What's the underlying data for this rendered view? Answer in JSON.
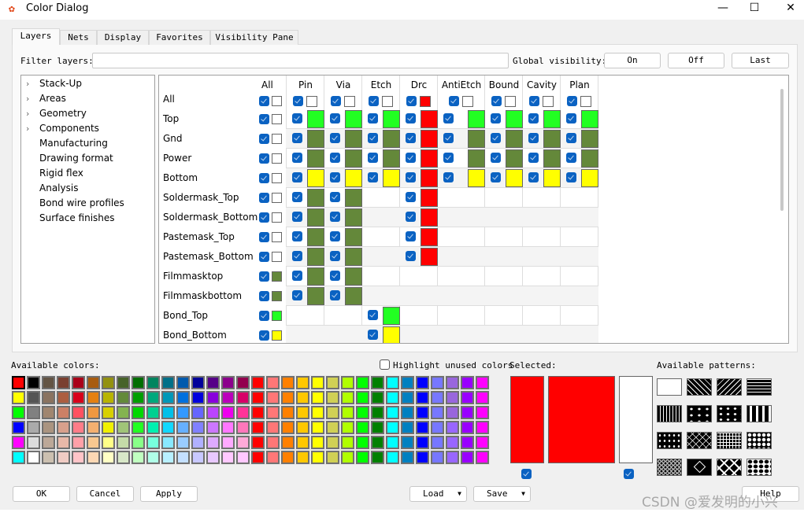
{
  "window": {
    "title": "Color Dialog",
    "icon": "color-palette-icon",
    "minimize": "—",
    "maximize": "☐",
    "close": "✕"
  },
  "tabs": [
    {
      "label": "Layers",
      "active": true
    },
    {
      "label": "Nets"
    },
    {
      "label": "Display"
    },
    {
      "label": "Favorites"
    },
    {
      "label": "Visibility Pane"
    }
  ],
  "filter": {
    "label": "Filter layers:",
    "value": "",
    "placeholder": ""
  },
  "global_visibility": {
    "label": "Global visibility:",
    "on": "On",
    "off": "Off",
    "last": "Last"
  },
  "tree": [
    {
      "label": "Stack-Up",
      "expandable": true
    },
    {
      "label": "Areas",
      "expandable": true
    },
    {
      "label": "Geometry",
      "expandable": true
    },
    {
      "label": "Components",
      "expandable": true
    },
    {
      "label": "Manufacturing"
    },
    {
      "label": "Drawing format"
    },
    {
      "label": "Rigid flex"
    },
    {
      "label": "Analysis"
    },
    {
      "label": "Bond wire profiles"
    },
    {
      "label": "Surface finishes"
    }
  ],
  "grid": {
    "all_header": "All",
    "columns": [
      "Pin",
      "Via",
      "Etch",
      "Drc",
      "AntiEtch",
      "Bound",
      "Cavity",
      "Plan"
    ],
    "all_row": {
      "name": "All",
      "all_color": "#ffffff",
      "colors": [
        "#ffffff",
        "#ffffff",
        "#ffffff",
        "#ff0000",
        "#ffffff",
        "#ffffff",
        "#ffffff",
        "#ffffff"
      ]
    },
    "rows": [
      {
        "name": "Top",
        "all_color": "#ffffff",
        "cells": [
          "#22ff22",
          "#22ff22",
          "#22ff22",
          "#ff0000",
          "#22ff22",
          "#22ff22",
          "#22ff22",
          "#22ff22"
        ]
      },
      {
        "name": "Gnd",
        "all_color": "#ffffff",
        "cells": [
          "#64883a",
          "#64883a",
          "#64883a",
          "#ff0000",
          "#64883a",
          "#64883a",
          "#64883a",
          "#64883a"
        ]
      },
      {
        "name": "Power",
        "all_color": "#ffffff",
        "cells": [
          "#64883a",
          "#64883a",
          "#64883a",
          "#ff0000",
          "#64883a",
          "#64883a",
          "#64883a",
          "#64883a"
        ]
      },
      {
        "name": "Bottom",
        "all_color": "#ffffff",
        "cells": [
          "#ffff00",
          "#ffff00",
          "#ffff00",
          "#ff0000",
          "#ffff00",
          "#ffff00",
          "#ffff00",
          "#ffff00"
        ]
      },
      {
        "name": "Soldermask_Top",
        "all_color": "#ffffff",
        "cells": [
          "#64883a",
          "#64883a",
          null,
          "#ff0000",
          null,
          null,
          null,
          null
        ]
      },
      {
        "name": "Soldermask_Bottom",
        "all_color": "#ffffff",
        "cells": [
          "#64883a",
          "#64883a",
          null,
          "#ff0000",
          null,
          null,
          null,
          null
        ]
      },
      {
        "name": "Pastemask_Top",
        "all_color": "#ffffff",
        "cells": [
          "#64883a",
          "#64883a",
          null,
          "#ff0000",
          null,
          null,
          null,
          null
        ]
      },
      {
        "name": "Pastemask_Bottom",
        "all_color": "#ffffff",
        "cells": [
          "#64883a",
          "#64883a",
          null,
          "#ff0000",
          null,
          null,
          null,
          null
        ]
      },
      {
        "name": "Filmmasktop",
        "all_color": "#64883a",
        "cells": [
          "#64883a",
          "#64883a",
          null,
          null,
          null,
          null,
          null,
          null
        ]
      },
      {
        "name": "Filmmaskbottom",
        "all_color": "#64883a",
        "cells": [
          "#64883a",
          "#64883a",
          null,
          null,
          null,
          null,
          null,
          null
        ]
      },
      {
        "name": "Bond_Top",
        "all_color": "#22ff22",
        "cells": [
          null,
          null,
          "#22ff22",
          null,
          null,
          null,
          null,
          null
        ]
      },
      {
        "name": "Bond_Bottom",
        "all_color": "#ffff00",
        "cells": [
          null,
          null,
          "#ffff00",
          null,
          null,
          null,
          null,
          null
        ]
      }
    ]
  },
  "available_colors": {
    "label": "Available colors:",
    "selected_index": 0,
    "rows": [
      [
        "#ff0000",
        "#000000",
        "#635444",
        "#7a4030",
        "#aa0018",
        "#a85c10",
        "#939110",
        "#476329",
        "#006e00",
        "#00855f",
        "#007088",
        "#005aad",
        "#00009a",
        "#560088",
        "#8c008c",
        "#93004e"
      ],
      [
        "#ffff00",
        "#555555",
        "#8a7360",
        "#ac5e40",
        "#d8001a",
        "#e48010",
        "#b8b400",
        "#638a3a",
        "#009e00",
        "#00a87c",
        "#0098b8",
        "#0070dd",
        "#0000dd",
        "#8800dd",
        "#bb00bb",
        "#d70068"
      ],
      [
        "#00ff00",
        "#808080",
        "#a08670",
        "#cc8066",
        "#ff5060",
        "#f09840",
        "#d8d000",
        "#84b450",
        "#00d800",
        "#00d090",
        "#00c0e8",
        "#3399ff",
        "#6666ff",
        "#bb44ff",
        "#ee00ee",
        "#ff3399"
      ],
      [
        "#0000ff",
        "#aaaaaa",
        "#aa9480",
        "#d8a08c",
        "#ff7c88",
        "#f4b070",
        "#f0f000",
        "#a0c478",
        "#22ff22",
        "#00f0b0",
        "#11d8ff",
        "#66b0ff",
        "#8080ff",
        "#cc77ff",
        "#ff77ff",
        "#ff77bb"
      ],
      [
        "#ff00ff",
        "#dddddd",
        "#bca898",
        "#e8b8a8",
        "#ffa0a8",
        "#f8c890",
        "#ffff88",
        "#c4dca8",
        "#88ff88",
        "#77ffdd",
        "#88e8ff",
        "#99ccff",
        "#b0b0ff",
        "#ddaaff",
        "#ffaaff",
        "#ffaad8"
      ],
      [
        "#00ffff",
        "#ffffff",
        "#ccc0b0",
        "#f0ccc4",
        "#ffc4c8",
        "#fcd8b4",
        "#ffffc4",
        "#d8e8c8",
        "#c0ffc0",
        "#b0ffe8",
        "#b8f0ff",
        "#c4e0ff",
        "#c8c8ff",
        "#e8c8ff",
        "#ffc8ff",
        "#ffc8ff"
      ]
    ],
    "custom": [
      "#ff0000",
      "#ff7777",
      "#ff8000",
      "#ffc800",
      "#ffff00",
      "#d0d055",
      "#b0ff00",
      "#00ff00",
      "#008000",
      "#00ffff",
      "#0080c0",
      "#0000ff",
      "#7777ff",
      "#9966dd",
      "#9900ff",
      "#ff00ff"
    ]
  },
  "highlight_unused": {
    "label": "Highlight unused colors",
    "checked": false
  },
  "selected": {
    "label": "Selected:",
    "color1": "#ff0000",
    "color2": "#ff0000",
    "color3": "#ffffff",
    "check1": true,
    "check2": true
  },
  "patterns": {
    "label": "Available patterns:",
    "names": [
      "solid-white",
      "diagonal-down",
      "diagonal-up",
      "horizontal-lines",
      "vertical-lines",
      "triangles",
      "crosses",
      "dashes",
      "dots-vertical",
      "diamond-grid",
      "square-grid",
      "dots-large",
      "circles",
      "diamond-single",
      "x-grid",
      "diamonds"
    ]
  },
  "buttons": {
    "ok": "OK",
    "cancel": "Cancel",
    "apply": "Apply",
    "load": "Load",
    "save": "Save",
    "help": "Help"
  },
  "watermark": "CSDN @爱发明的小兴"
}
